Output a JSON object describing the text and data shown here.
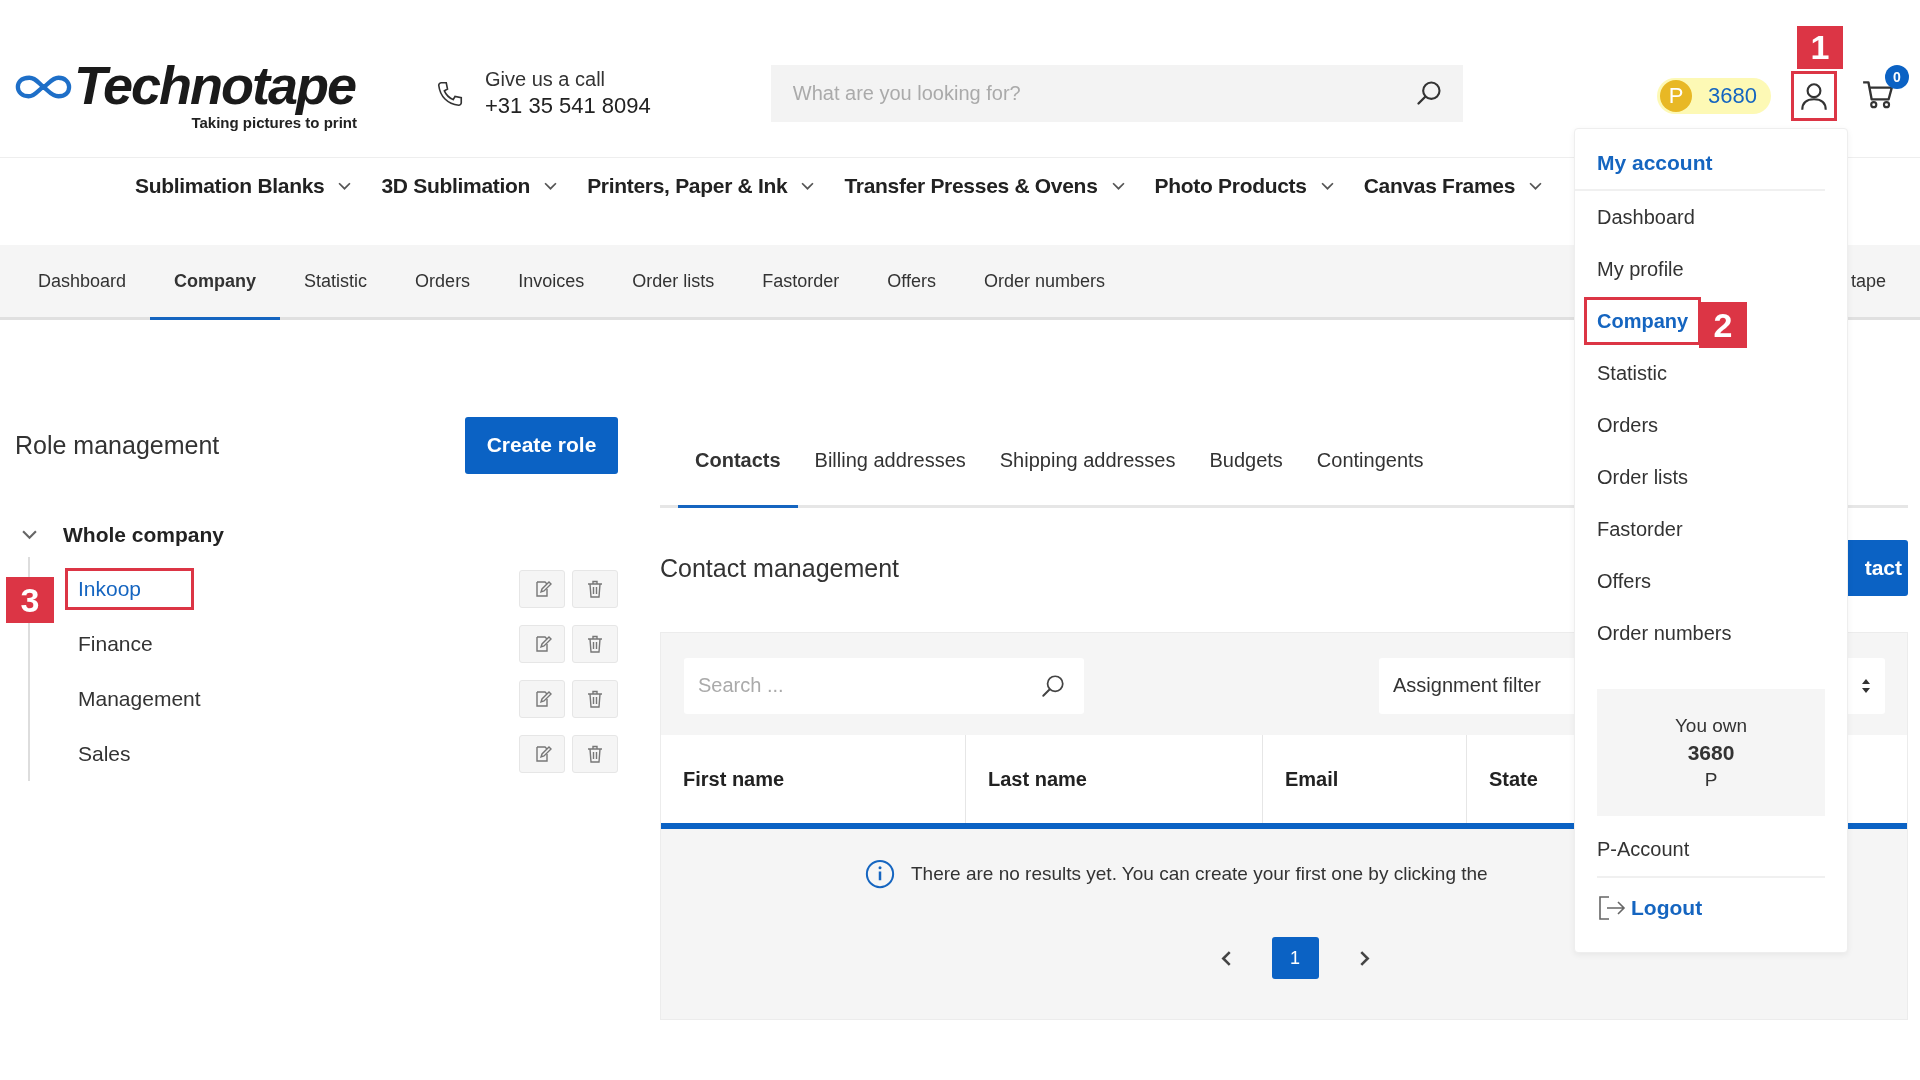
{
  "logo": {
    "name": "Technotape",
    "tagline": "Taking pictures to print"
  },
  "contact": {
    "label": "Give us a call",
    "phone": "+31 35 541 8094"
  },
  "search": {
    "placeholder": "What are you looking for?"
  },
  "points": {
    "letter": "P",
    "amount": "3680"
  },
  "cart": {
    "count": "0"
  },
  "nav": [
    {
      "label": "Sublimation Blanks"
    },
    {
      "label": "3D Sublimation"
    },
    {
      "label": "Printers, Paper & Ink"
    },
    {
      "label": "Transfer Presses & Ovens"
    },
    {
      "label": "Photo Products"
    },
    {
      "label": "Canvas Frames"
    }
  ],
  "subnav": [
    {
      "label": "Dashboard",
      "selected": false
    },
    {
      "label": "Company",
      "selected": true
    },
    {
      "label": "Statistic",
      "selected": false
    },
    {
      "label": "Orders",
      "selected": false
    },
    {
      "label": "Invoices",
      "selected": false
    },
    {
      "label": "Order lists",
      "selected": false
    },
    {
      "label": "Fastorder",
      "selected": false
    },
    {
      "label": "Offers",
      "selected": false
    },
    {
      "label": "Order numbers",
      "selected": false
    },
    {
      "label": "tape",
      "selected": false
    }
  ],
  "roles": {
    "title": "Role management",
    "create_button": "Create role",
    "tree": {
      "label": "Whole company",
      "expanded": true,
      "children": [
        {
          "label": "Inkoop",
          "selected": true
        },
        {
          "label": "Finance",
          "selected": false
        },
        {
          "label": "Management",
          "selected": false
        },
        {
          "label": "Sales",
          "selected": false
        }
      ]
    }
  },
  "tabs": [
    {
      "label": "Contacts",
      "selected": true
    },
    {
      "label": "Billing addresses",
      "selected": false
    },
    {
      "label": "Shipping addresses",
      "selected": false
    },
    {
      "label": "Budgets",
      "selected": false
    },
    {
      "label": "Contingents",
      "selected": false
    }
  ],
  "contacts": {
    "title": "Contact management",
    "add_button": "tact",
    "search_placeholder": "Search ...",
    "filter": "Assignment filter",
    "columns": [
      "First name",
      "Last name",
      "Email",
      "State"
    ],
    "empty_message": "There are no results yet. You can create your first one by clicking the",
    "pages": [
      {
        "label": "1",
        "selected": true
      }
    ]
  },
  "account_menu": {
    "title": "My account",
    "items": [
      {
        "label": "Dashboard",
        "selected": false
      },
      {
        "label": "My profile",
        "selected": false
      },
      {
        "label": "Company",
        "selected": true
      },
      {
        "label": "Statistic",
        "selected": false
      },
      {
        "label": "Orders",
        "selected": false
      },
      {
        "label": "Order lists",
        "selected": false
      },
      {
        "label": "Fastorder",
        "selected": false
      },
      {
        "label": "Offers",
        "selected": false
      },
      {
        "label": "Order numbers",
        "selected": false
      }
    ],
    "points_box": {
      "label": "You own",
      "amount": "3680",
      "unit": "P"
    },
    "p_account": "P-Account",
    "logout": "Logout"
  },
  "annotations": [
    {
      "label": "1"
    },
    {
      "label": "2"
    },
    {
      "label": "3"
    }
  ]
}
